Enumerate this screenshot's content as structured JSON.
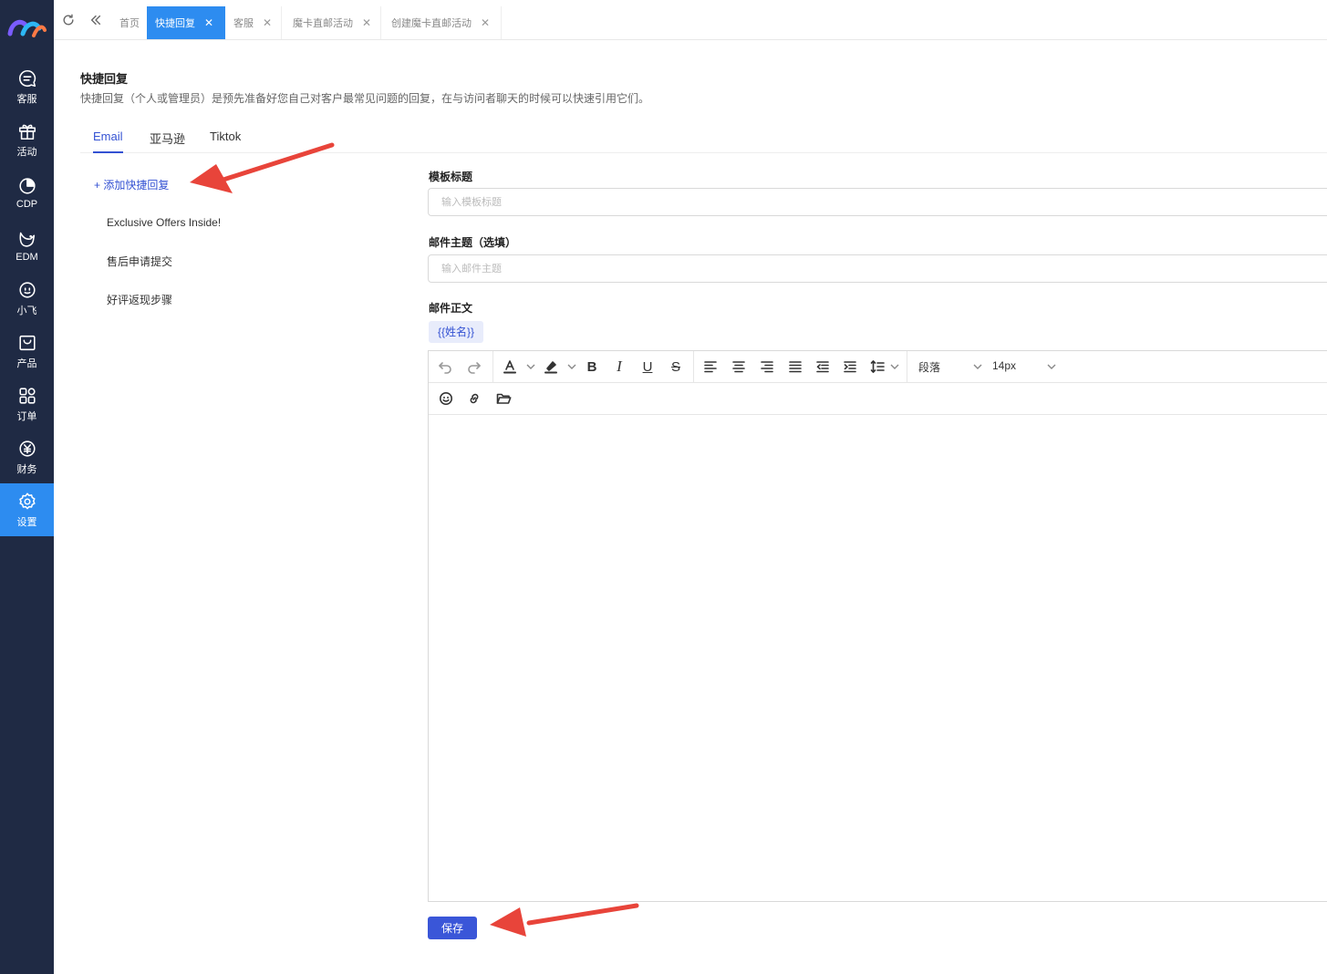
{
  "sidebar": {
    "items": [
      {
        "label": "客服",
        "icon": "chat-icon"
      },
      {
        "label": "活动",
        "icon": "gift-icon"
      },
      {
        "label": "CDP",
        "icon": "pie-chart-icon"
      },
      {
        "label": "EDM",
        "icon": "bird-icon"
      },
      {
        "label": "小飞",
        "icon": "bot-icon"
      },
      {
        "label": "产品",
        "icon": "bag-icon"
      },
      {
        "label": "订单",
        "icon": "grid-icon"
      },
      {
        "label": "财务",
        "icon": "yuan-icon"
      },
      {
        "label": "设置",
        "icon": "gear-icon",
        "active": true
      }
    ]
  },
  "tabs": [
    {
      "label": "首页",
      "closable": false
    },
    {
      "label": "快捷回复",
      "active": true
    },
    {
      "label": "客服"
    },
    {
      "label": "魔卡直邮活动"
    },
    {
      "label": "创建魔卡直邮活动"
    }
  ],
  "page": {
    "title": "快捷回复",
    "description": "快捷回复（个人或管理员）是预先准备好您自己对客户最常见问题的回复，在与访问者聊天的时候可以快速引用它们。"
  },
  "channel_tabs": [
    {
      "label": "Email",
      "active": true
    },
    {
      "label": "亚马逊"
    },
    {
      "label": "Tiktok"
    }
  ],
  "reply_list": {
    "add_label": "+ 添加快捷回复",
    "items": [
      "Exclusive Offers Inside!",
      "售后申请提交",
      "好评返现步骤"
    ]
  },
  "form": {
    "title_label": "模板标题",
    "title_placeholder": "输入模板标题",
    "title_value": "",
    "subject_label": "邮件主题（选填）",
    "subject_placeholder": "输入邮件主题",
    "subject_value": "",
    "body_label": "邮件正文",
    "variable_tag": "{{姓名}}",
    "paragraph_select": "段落",
    "fontsize_select": "14px",
    "save_label": "保存"
  },
  "colors": {
    "sidebar_bg": "#1f2a44",
    "active_blue": "#2d8cf0",
    "accent": "#3452d3",
    "annotation_red": "#e8443a"
  }
}
